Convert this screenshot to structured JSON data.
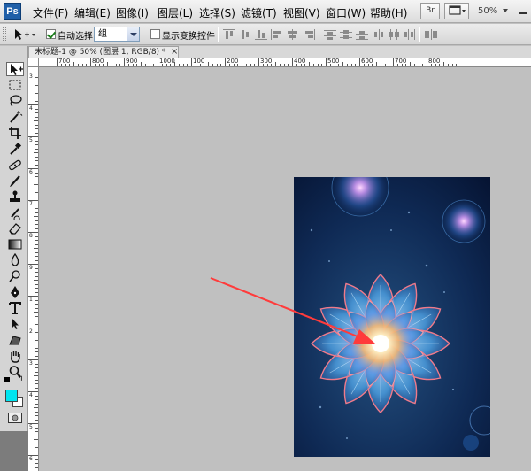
{
  "app": {
    "logo": "Ps",
    "menu": [
      "文件(F)",
      "编辑(E)",
      "图像(I)",
      "图层(L)",
      "选择(S)",
      "滤镜(T)",
      "视图(V)",
      "窗口(W)",
      "帮助(H)"
    ],
    "bridge_label": "Br",
    "zoom": "50%"
  },
  "options": {
    "auto_select_label": "自动选择:",
    "auto_select_checked": true,
    "auto_select_value": "组",
    "show_transform_label": "显示变换控件",
    "show_transform_checked": false
  },
  "document": {
    "tab_title": "未标题-1 @ 50% (图层 1, RGB/8) *",
    "close": "×"
  },
  "ruler": {
    "top_labels": [
      "700",
      "800",
      "900",
      "1000",
      "100",
      "200",
      "300",
      "400",
      "500",
      "600",
      "700",
      "800"
    ],
    "left_labels": [
      "3",
      "4",
      "5",
      "6",
      "7",
      "8",
      "9",
      "1",
      "2",
      "3",
      "4",
      "5",
      "6"
    ]
  },
  "colors": {
    "foreground": "#00e5f0",
    "background": "#ffffff",
    "arrow": "#ff3b3b"
  },
  "tools": [
    "move-tool",
    "marquee-tool",
    "lasso-tool",
    "magic-wand-tool",
    "crop-tool",
    "eyedropper-tool",
    "healing-brush-tool",
    "brush-tool",
    "clone-stamp-tool",
    "history-brush-tool",
    "eraser-tool",
    "gradient-tool",
    "blur-tool",
    "dodge-tool",
    "pen-tool",
    "type-tool",
    "path-selection-tool",
    "shape-tool",
    "hand-tool",
    "zoom-tool"
  ]
}
